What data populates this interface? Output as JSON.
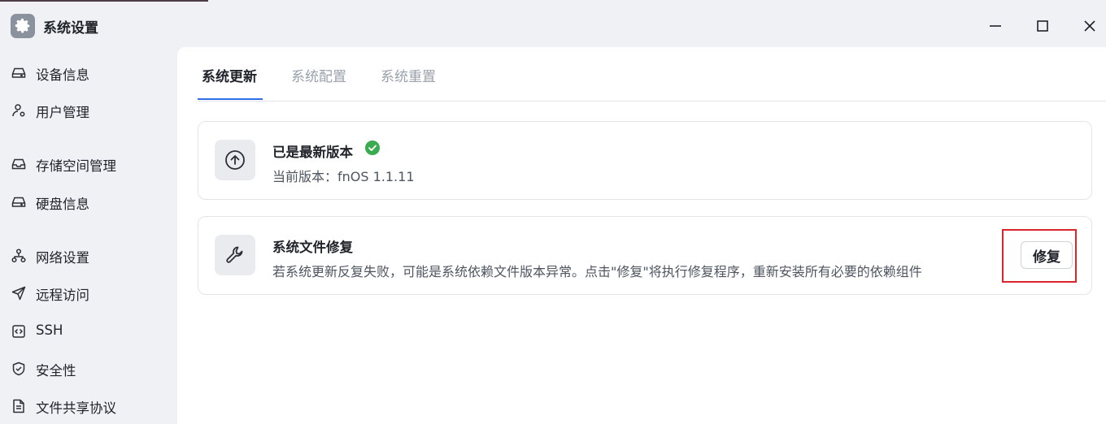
{
  "window": {
    "title": "系统设置",
    "app_icon": "gear-icon",
    "controls": [
      "minimize-icon",
      "maximize-icon",
      "close-icon"
    ]
  },
  "sidebar": {
    "items": [
      {
        "label": "设备信息",
        "icon": "drive-icon"
      },
      {
        "label": "用户管理",
        "icon": "user-gear-icon"
      },
      {
        "label": "存储空间管理",
        "icon": "inbox-icon"
      },
      {
        "label": "硬盘信息",
        "icon": "drive-icon"
      },
      {
        "label": "网络设置",
        "icon": "network-icon"
      },
      {
        "label": "远程访问",
        "icon": "send-icon"
      },
      {
        "label": "SSH",
        "icon": "code-icon"
      },
      {
        "label": "安全性",
        "icon": "shield-icon"
      },
      {
        "label": "文件共享协议",
        "icon": "document-icon"
      }
    ]
  },
  "tabs": [
    {
      "label": "系统更新",
      "active": true
    },
    {
      "label": "系统配置",
      "active": false
    },
    {
      "label": "系统重置",
      "active": false
    }
  ],
  "update_card": {
    "title": "已是最新版本",
    "status_icon": "check-circle-icon",
    "status_color": "#3bab4f",
    "subtitle": "当前版本：fnOS 1.1.11",
    "icon": "arrow-up-circle-icon"
  },
  "repair_card": {
    "title": "系统文件修复",
    "description": "若系统更新反复失败，可能是系统依赖文件版本异常。点击\"修复\"将执行修复程序，重新安装所有必要的依赖组件",
    "icon": "wrench-icon",
    "button_label": "修复",
    "highlight_color": "#d9252b"
  },
  "colors": {
    "accent": "#2f6fea",
    "sidebar_bg": "#f0f1f4",
    "main_bg": "#ffffff"
  }
}
